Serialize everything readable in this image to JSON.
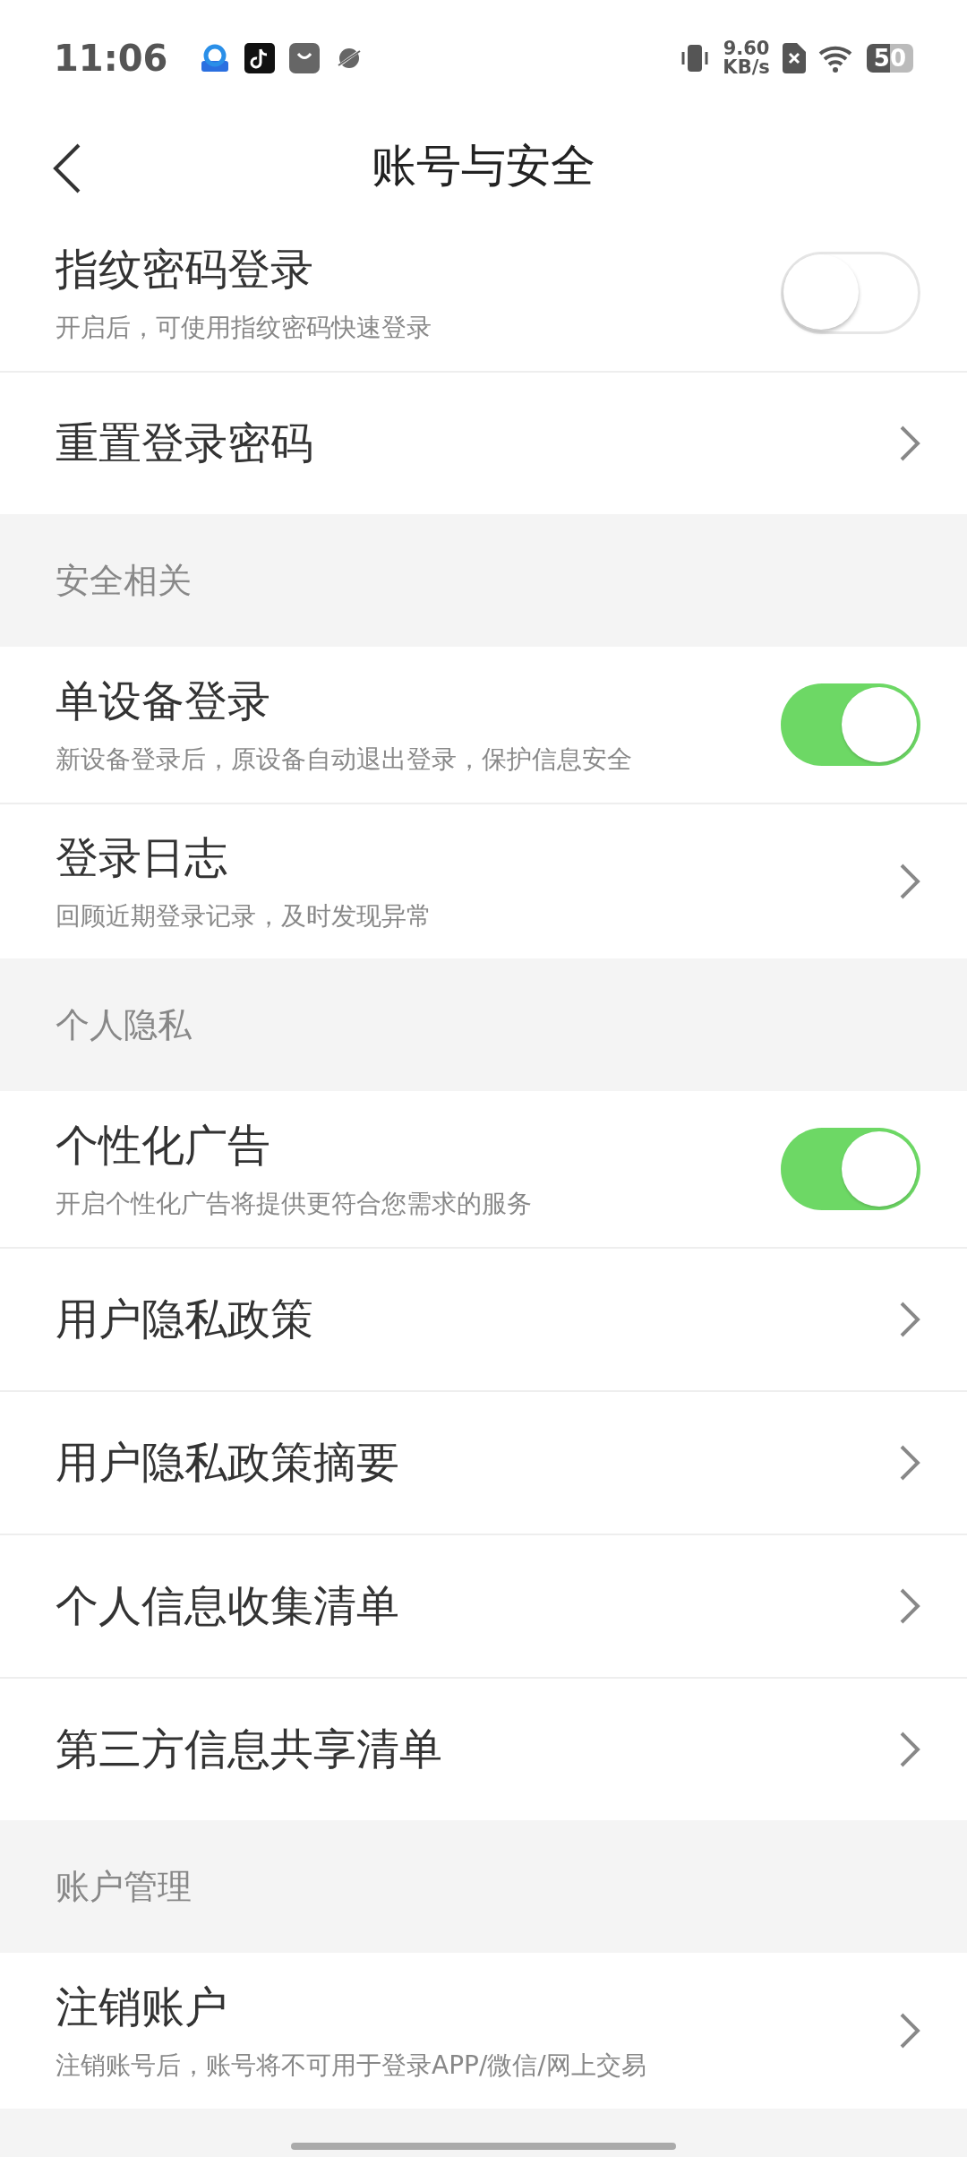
{
  "status_bar": {
    "time": "11:06",
    "net_speed": "9.60",
    "net_unit": "KB/s",
    "battery": "50"
  },
  "header": {
    "title": "账号与安全"
  },
  "sections": [
    {
      "rows": [
        {
          "kind": "toggle",
          "title": "指纹密码登录",
          "subtitle": "开启后，可使用指纹密码快速登录",
          "on": false
        },
        {
          "kind": "link",
          "title": "重置登录密码"
        }
      ]
    },
    {
      "title": "安全相关",
      "rows": [
        {
          "kind": "toggle",
          "title": "单设备登录",
          "subtitle": "新设备登录后，原设备自动退出登录，保护信息安全",
          "on": true
        },
        {
          "kind": "link",
          "title": "登录日志",
          "subtitle": "回顾近期登录记录，及时发现异常"
        }
      ]
    },
    {
      "title": "个人隐私",
      "rows": [
        {
          "kind": "toggle",
          "title": "个性化广告",
          "subtitle": "开启个性化广告将提供更符合您需求的服务",
          "on": true
        },
        {
          "kind": "link",
          "title": "用户隐私政策"
        },
        {
          "kind": "link",
          "title": "用户隐私政策摘要"
        },
        {
          "kind": "link",
          "title": "个人信息收集清单"
        },
        {
          "kind": "link",
          "title": "第三方信息共享清单"
        }
      ]
    },
    {
      "title": "账户管理",
      "rows": [
        {
          "kind": "link",
          "title": "注销账户",
          "subtitle": "注销账号后，账号将不可用于登录APP/微信/网上交易"
        }
      ]
    }
  ]
}
